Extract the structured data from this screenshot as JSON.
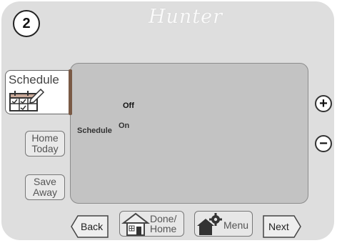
{
  "step": "2",
  "brand": "Hunter",
  "tabs": {
    "schedule": "Schedule"
  },
  "side_buttons": [
    {
      "line1": "Home",
      "line2": "Today"
    },
    {
      "line1": "Save",
      "line2": "Away"
    }
  ],
  "screen": {
    "off_label": "Off",
    "on_label": "On",
    "schedule_label": "Schedule"
  },
  "controls": {
    "plus": "+",
    "minus": "−"
  },
  "bottom": {
    "back": "Back",
    "done_line1": "Done/",
    "done_line2": "Home",
    "menu": "Menu",
    "next": "Next"
  }
}
